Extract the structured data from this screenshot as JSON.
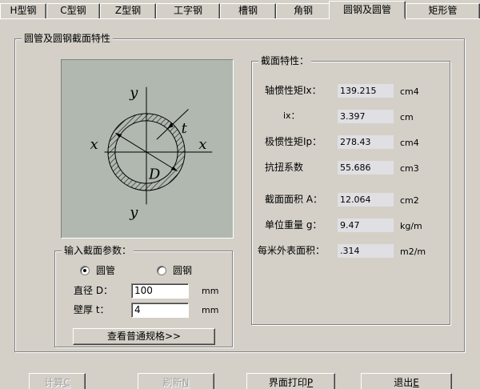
{
  "tabs": [
    {
      "label": "H型钢"
    },
    {
      "label": "C型钢"
    },
    {
      "label": "Z型钢"
    },
    {
      "label": "工字钢"
    },
    {
      "label": "槽钢"
    },
    {
      "label": "角钢"
    },
    {
      "label": "圆钢及圆管"
    },
    {
      "label": "矩形管"
    }
  ],
  "main_group": {
    "title": "圆管及圆钢截面特性"
  },
  "drawing": {
    "y_top": "y",
    "y_bottom": "y",
    "x_left": "x",
    "x_right": "x",
    "t": "t",
    "D": "D"
  },
  "properties": {
    "title": "截面特性：",
    "rows": [
      {
        "label": "轴惯性矩Ix：",
        "value": "139.215",
        "unit": "cm4"
      },
      {
        "label": "ix：",
        "value": "3.397",
        "unit": "cm"
      },
      {
        "label": "极惯性矩Ip：",
        "value": "278.43",
        "unit": "cm4"
      },
      {
        "label": "抗扭系数",
        "value": "55.686",
        "unit": "cm3"
      },
      {
        "label": "截面面积 A：",
        "value": "12.064",
        "unit": "cm2"
      },
      {
        "label": "单位重量 g：",
        "value": "9.47",
        "unit": "kg/m"
      },
      {
        "label": "每米外表面积：",
        "value": ".314",
        "unit": "m2/m"
      }
    ]
  },
  "input_group": {
    "title": "输入截面参数：",
    "radio_tube": "圆管",
    "radio_solid": "圆钢",
    "diameter_label": "直径 D：",
    "diameter_value": "100",
    "diameter_unit": "mm",
    "thickness_label": "壁厚 t：",
    "thickness_value": "4",
    "thickness_unit": "mm",
    "spec_button": "查看普通规格>>"
  },
  "buttons": {
    "calc": "计算",
    "calc_key": "C",
    "refresh": "刷新",
    "refresh_key": "N",
    "print": "界面打印",
    "print_key": "P",
    "exit": "退出",
    "exit_key": "E"
  }
}
